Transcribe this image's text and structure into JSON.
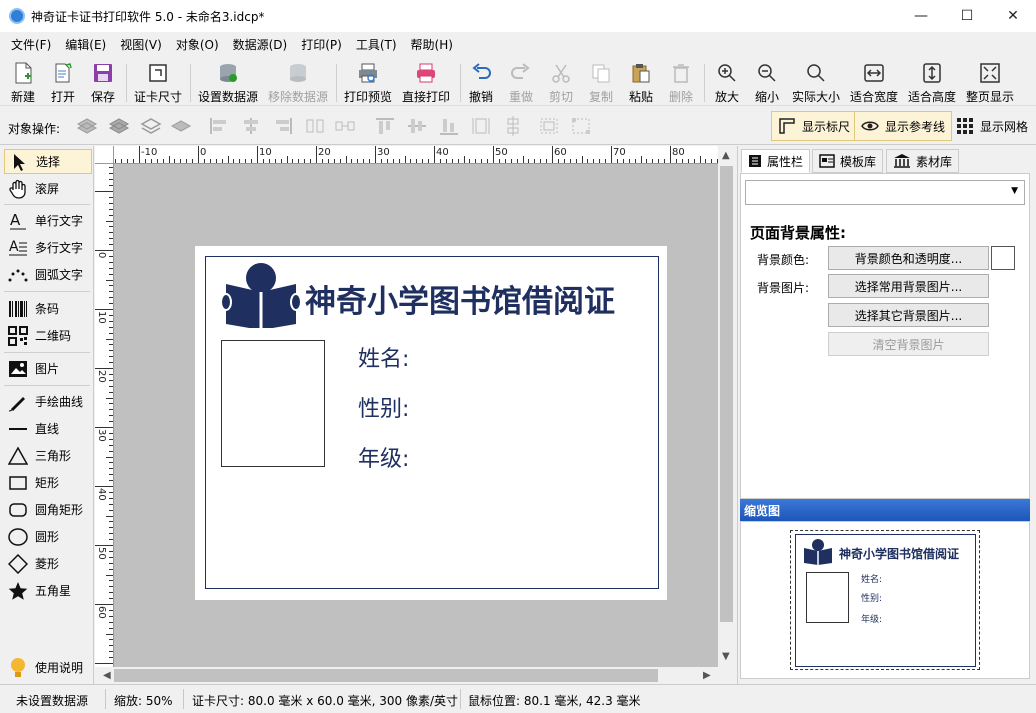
{
  "window": {
    "title": "神奇证卡证书打印软件 5.0 - 未命名3.idcp*",
    "minimize": "—",
    "maximize": "☐",
    "close": "✕"
  },
  "menu": [
    "文件(F)",
    "编辑(E)",
    "视图(V)",
    "对象(O)",
    "数据源(D)",
    "打印(P)",
    "工具(T)",
    "帮助(H)"
  ],
  "toolbar": {
    "new": "新建",
    "open": "打开",
    "save": "保存",
    "card_size": "证卡尺寸",
    "set_datasource": "设置数据源",
    "remove_datasource": "移除数据源",
    "print_preview": "打印预览",
    "direct_print": "直接打印",
    "undo": "撤销",
    "redo": "重做",
    "cut": "剪切",
    "copy": "复制",
    "paste": "粘贴",
    "delete": "删除",
    "zoom_in": "放大",
    "zoom_out": "缩小",
    "actual_size": "实际大小",
    "fit_width": "适合宽度",
    "fit_height": "适合高度",
    "fit_page": "整页显示"
  },
  "opsbar": {
    "label": "对象操作:",
    "show_ruler": "显示标尺",
    "show_guides": "显示参考线",
    "show_grid": "显示网格"
  },
  "tools": {
    "select": "选择",
    "scroll": "滚屏",
    "single_text": "单行文字",
    "multi_text": "多行文字",
    "arc_text": "圆弧文字",
    "barcode": "条码",
    "qrcode": "二维码",
    "image": "图片",
    "freehand": "手绘曲线",
    "line": "直线",
    "triangle": "三角形",
    "rectangle": "矩形",
    "rounded_rect": "圆角矩形",
    "ellipse": "圆形",
    "diamond": "菱形",
    "star": "五角星",
    "help": "使用说明"
  },
  "ruler": {
    "top_labels": [
      "-10",
      "0",
      "10",
      "20",
      "30",
      "40",
      "50",
      "60",
      "70",
      "80"
    ],
    "left_labels": [
      "0",
      "10",
      "20",
      "30",
      "40",
      "50",
      "60"
    ]
  },
  "card": {
    "title": "神奇小学图书馆借阅证",
    "name_label": "姓名:",
    "gender_label": "性别:",
    "grade_label": "年级:",
    "brand_color": "#1e2f60"
  },
  "right_panel": {
    "tabs": [
      "属性栏",
      "模板库",
      "素材库"
    ],
    "section_title": "页面背景属性:",
    "bg_color_label": "背景颜色:",
    "bg_color_button": "背景颜色和透明度...",
    "bg_image_label": "背景图片:",
    "choose_common_bg": "选择常用背景图片...",
    "choose_other_bg": "选择其它背景图片...",
    "clear_bg": "清空背景图片",
    "thumbnail_header": "缩览图"
  },
  "status": {
    "datasource": "未设置数据源",
    "zoom": "缩放: 50%",
    "card_size": "证卡尺寸: 80.0 毫米 x 60.0 毫米, 300 像素/英寸",
    "mouse_pos": "鼠标位置: 80.1 毫米, 42.3 毫米"
  }
}
